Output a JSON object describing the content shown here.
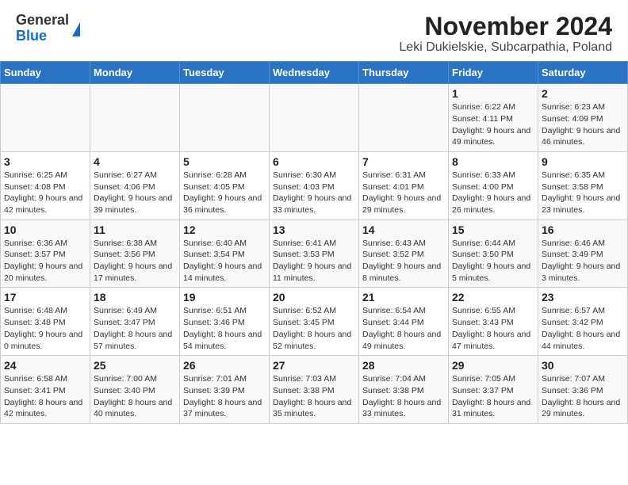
{
  "logo": {
    "general": "General",
    "blue": "Blue"
  },
  "title": "November 2024",
  "subtitle": "Leki Dukielskie, Subcarpathia, Poland",
  "weekdays": [
    "Sunday",
    "Monday",
    "Tuesday",
    "Wednesday",
    "Thursday",
    "Friday",
    "Saturday"
  ],
  "weeks": [
    [
      {
        "day": "",
        "info": ""
      },
      {
        "day": "",
        "info": ""
      },
      {
        "day": "",
        "info": ""
      },
      {
        "day": "",
        "info": ""
      },
      {
        "day": "",
        "info": ""
      },
      {
        "day": "1",
        "info": "Sunrise: 6:22 AM\nSunset: 4:11 PM\nDaylight: 9 hours and 49 minutes."
      },
      {
        "day": "2",
        "info": "Sunrise: 6:23 AM\nSunset: 4:09 PM\nDaylight: 9 hours and 46 minutes."
      }
    ],
    [
      {
        "day": "3",
        "info": "Sunrise: 6:25 AM\nSunset: 4:08 PM\nDaylight: 9 hours and 42 minutes."
      },
      {
        "day": "4",
        "info": "Sunrise: 6:27 AM\nSunset: 4:06 PM\nDaylight: 9 hours and 39 minutes."
      },
      {
        "day": "5",
        "info": "Sunrise: 6:28 AM\nSunset: 4:05 PM\nDaylight: 9 hours and 36 minutes."
      },
      {
        "day": "6",
        "info": "Sunrise: 6:30 AM\nSunset: 4:03 PM\nDaylight: 9 hours and 33 minutes."
      },
      {
        "day": "7",
        "info": "Sunrise: 6:31 AM\nSunset: 4:01 PM\nDaylight: 9 hours and 29 minutes."
      },
      {
        "day": "8",
        "info": "Sunrise: 6:33 AM\nSunset: 4:00 PM\nDaylight: 9 hours and 26 minutes."
      },
      {
        "day": "9",
        "info": "Sunrise: 6:35 AM\nSunset: 3:58 PM\nDaylight: 9 hours and 23 minutes."
      }
    ],
    [
      {
        "day": "10",
        "info": "Sunrise: 6:36 AM\nSunset: 3:57 PM\nDaylight: 9 hours and 20 minutes."
      },
      {
        "day": "11",
        "info": "Sunrise: 6:38 AM\nSunset: 3:56 PM\nDaylight: 9 hours and 17 minutes."
      },
      {
        "day": "12",
        "info": "Sunrise: 6:40 AM\nSunset: 3:54 PM\nDaylight: 9 hours and 14 minutes."
      },
      {
        "day": "13",
        "info": "Sunrise: 6:41 AM\nSunset: 3:53 PM\nDaylight: 9 hours and 11 minutes."
      },
      {
        "day": "14",
        "info": "Sunrise: 6:43 AM\nSunset: 3:52 PM\nDaylight: 9 hours and 8 minutes."
      },
      {
        "day": "15",
        "info": "Sunrise: 6:44 AM\nSunset: 3:50 PM\nDaylight: 9 hours and 5 minutes."
      },
      {
        "day": "16",
        "info": "Sunrise: 6:46 AM\nSunset: 3:49 PM\nDaylight: 9 hours and 3 minutes."
      }
    ],
    [
      {
        "day": "17",
        "info": "Sunrise: 6:48 AM\nSunset: 3:48 PM\nDaylight: 9 hours and 0 minutes."
      },
      {
        "day": "18",
        "info": "Sunrise: 6:49 AM\nSunset: 3:47 PM\nDaylight: 8 hours and 57 minutes."
      },
      {
        "day": "19",
        "info": "Sunrise: 6:51 AM\nSunset: 3:46 PM\nDaylight: 8 hours and 54 minutes."
      },
      {
        "day": "20",
        "info": "Sunrise: 6:52 AM\nSunset: 3:45 PM\nDaylight: 8 hours and 52 minutes."
      },
      {
        "day": "21",
        "info": "Sunrise: 6:54 AM\nSunset: 3:44 PM\nDaylight: 8 hours and 49 minutes."
      },
      {
        "day": "22",
        "info": "Sunrise: 6:55 AM\nSunset: 3:43 PM\nDaylight: 8 hours and 47 minutes."
      },
      {
        "day": "23",
        "info": "Sunrise: 6:57 AM\nSunset: 3:42 PM\nDaylight: 8 hours and 44 minutes."
      }
    ],
    [
      {
        "day": "24",
        "info": "Sunrise: 6:58 AM\nSunset: 3:41 PM\nDaylight: 8 hours and 42 minutes."
      },
      {
        "day": "25",
        "info": "Sunrise: 7:00 AM\nSunset: 3:40 PM\nDaylight: 8 hours and 40 minutes."
      },
      {
        "day": "26",
        "info": "Sunrise: 7:01 AM\nSunset: 3:39 PM\nDaylight: 8 hours and 37 minutes."
      },
      {
        "day": "27",
        "info": "Sunrise: 7:03 AM\nSunset: 3:38 PM\nDaylight: 8 hours and 35 minutes."
      },
      {
        "day": "28",
        "info": "Sunrise: 7:04 AM\nSunset: 3:38 PM\nDaylight: 8 hours and 33 minutes."
      },
      {
        "day": "29",
        "info": "Sunrise: 7:05 AM\nSunset: 3:37 PM\nDaylight: 8 hours and 31 minutes."
      },
      {
        "day": "30",
        "info": "Sunrise: 7:07 AM\nSunset: 3:36 PM\nDaylight: 8 hours and 29 minutes."
      }
    ]
  ]
}
